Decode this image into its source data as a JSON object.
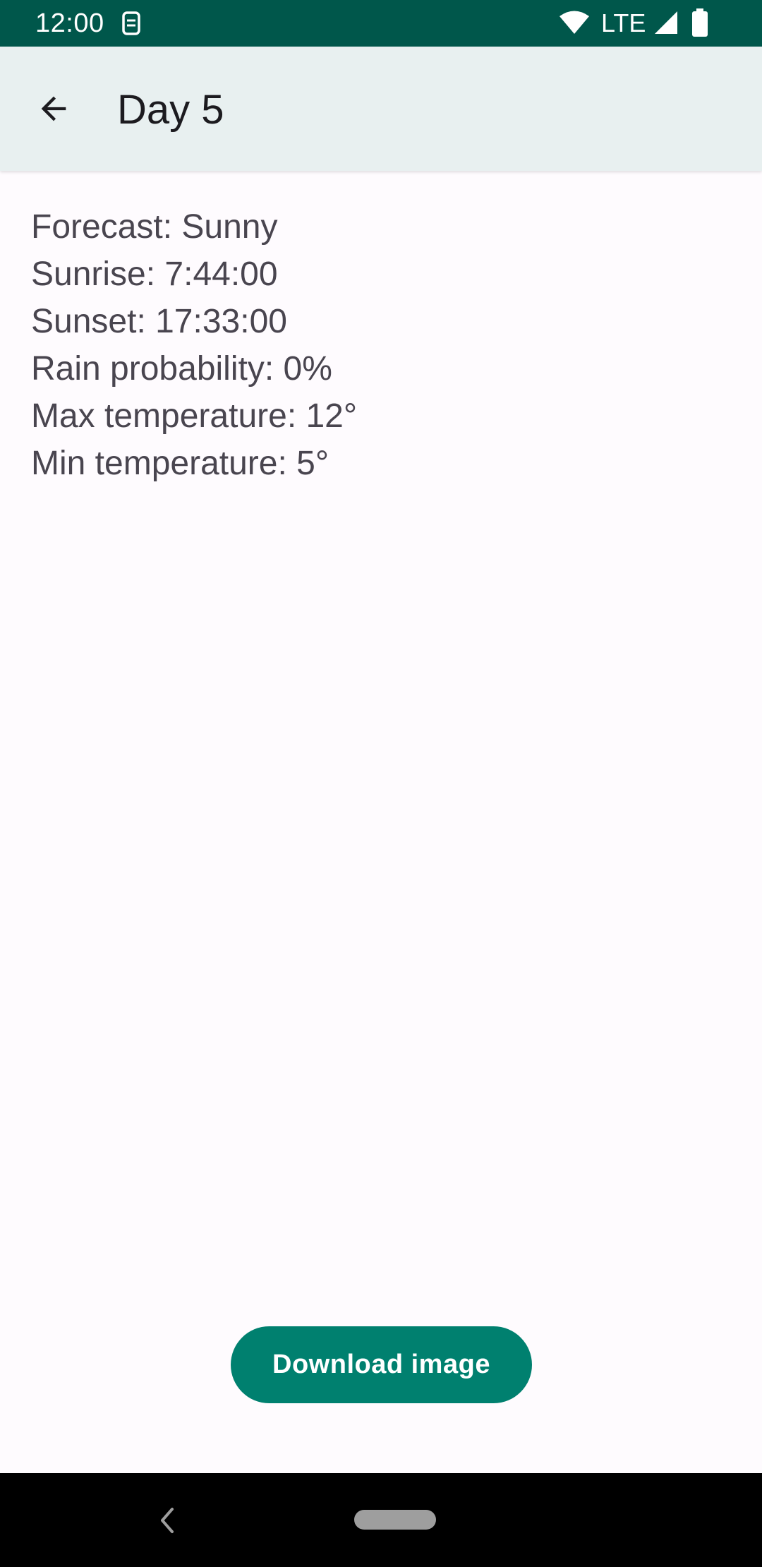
{
  "status_bar": {
    "time": "12:00",
    "network": "LTE",
    "icons": [
      "sim-card-icon",
      "wifi-icon",
      "signal-icon",
      "battery-icon"
    ]
  },
  "app_bar": {
    "back_icon": "arrow-back-icon",
    "title": "Day 5"
  },
  "details": {
    "forecast": "Forecast: Sunny",
    "sunrise": "Sunrise: 7:44:00",
    "sunset": "Sunset: 17:33:00",
    "rain_probability": "Rain probability: 0%",
    "max_temperature": "Max temperature: 12°",
    "min_temperature": "Min temperature: 5°"
  },
  "actions": {
    "download_label": "Download image"
  },
  "nav_bar": {
    "icons": [
      "nav-back-icon",
      "home-pill-icon"
    ]
  },
  "colors": {
    "status_bar": "#00574b",
    "app_bar": "#e8f0f0",
    "background": "#fefbfe",
    "accent": "#00806f",
    "text": "#49454f"
  }
}
